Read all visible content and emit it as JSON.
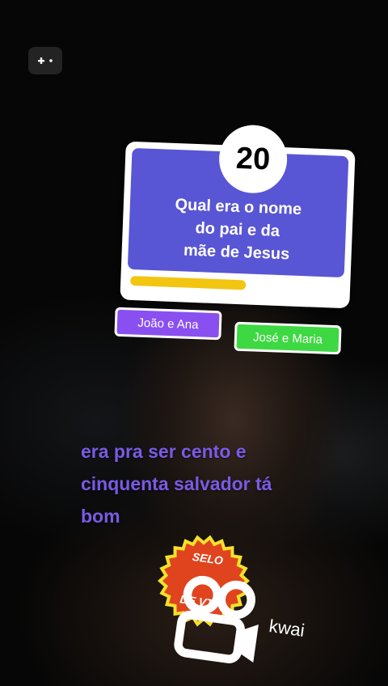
{
  "quiz": {
    "timer": "20",
    "question": "Qual era o nome\ndo pai e da\nmãe de Jesus",
    "progress": 0.55,
    "answers": [
      {
        "label": "João e Ana",
        "color": "#8a4ff0"
      },
      {
        "label": "José e Maria",
        "color": "#3ed843"
      }
    ]
  },
  "caption": {
    "lines": [
      "era pra ser cento e",
      "cinquenta salvador tá",
      "bom"
    ]
  },
  "seal": {
    "top": "SELO",
    "brand": "kwai",
    "bottom": "DE VT",
    "color": "#e0441f"
  },
  "icons": {
    "game": "gamepad-icon",
    "kwai": "kwai-camera-icon"
  }
}
